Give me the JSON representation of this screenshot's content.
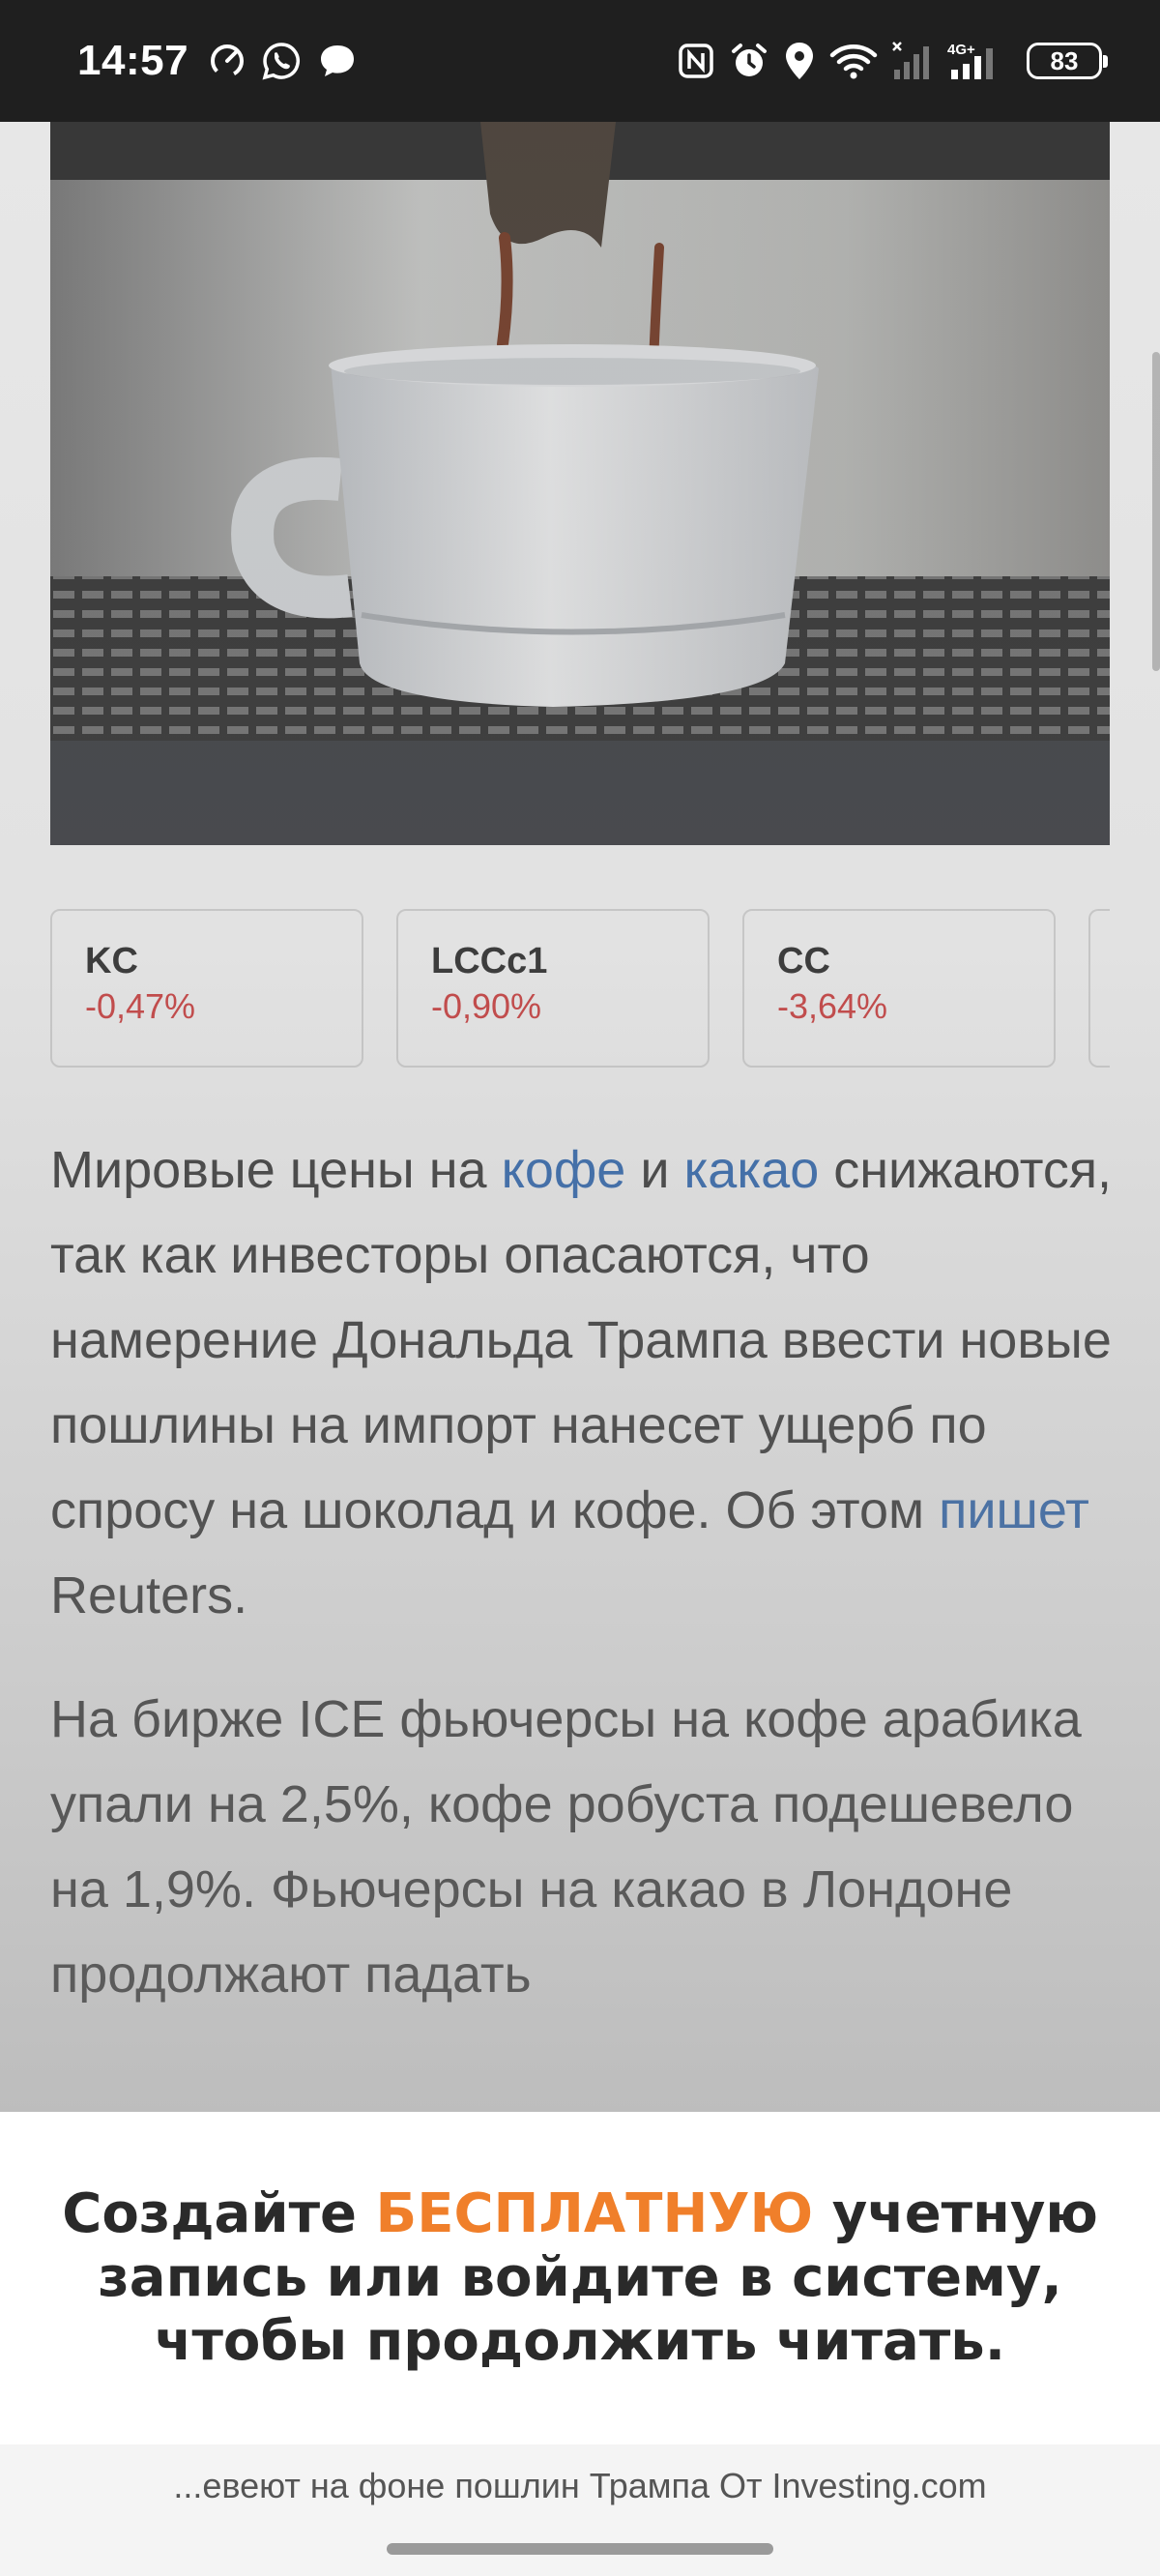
{
  "status_bar": {
    "time": "14:57",
    "battery": "83",
    "network": "4G+",
    "left_icons": [
      "speedometer-icon",
      "whatsapp-icon",
      "chat-bubble-icon"
    ],
    "right_icons": [
      "nfc-icon",
      "alarm-icon",
      "location-icon",
      "wifi-icon",
      "signal-icon",
      "signal-4g-icon",
      "battery-icon"
    ]
  },
  "tickers": [
    {
      "symbol": "KC",
      "change": "-0,47%"
    },
    {
      "symbol": "LCCc1",
      "change": "-0,90%"
    },
    {
      "symbol": "CC",
      "change": "-3,64%"
    }
  ],
  "article": {
    "p1": {
      "t1": "Мировые цены на ",
      "l1": "кофе",
      "t2": " и ",
      "l2": "какао",
      "t3": " снижаются, так как инвесторы опасаются, что намерение Дональда Трампа ввести новые пошлины на импорт нанесет ущерб по спросу на шоколад и кофе. Об этом ",
      "l3": "пишет",
      "t4": " Reuters."
    },
    "p2": "На бирже ICE фьючерсы на кофе арабика упали на 2,5%, кофе робуста подешевело на 1,9%. Фьючерсы на какао в Лондоне продолжают падать"
  },
  "signup": {
    "before": "Создайте ",
    "accent": "БЕСПЛАТНУЮ",
    "after": " учетную запись или войдите в систему, чтобы продолжить читать."
  },
  "url_bar": {
    "text": "...евеют на фоне пошлин Трампа От Investing.com"
  },
  "colors": {
    "accent": "#f07f2a",
    "link": "#1f5fb3",
    "negative": "#d32f2f",
    "status_bar_bg": "#1f1f1f"
  }
}
